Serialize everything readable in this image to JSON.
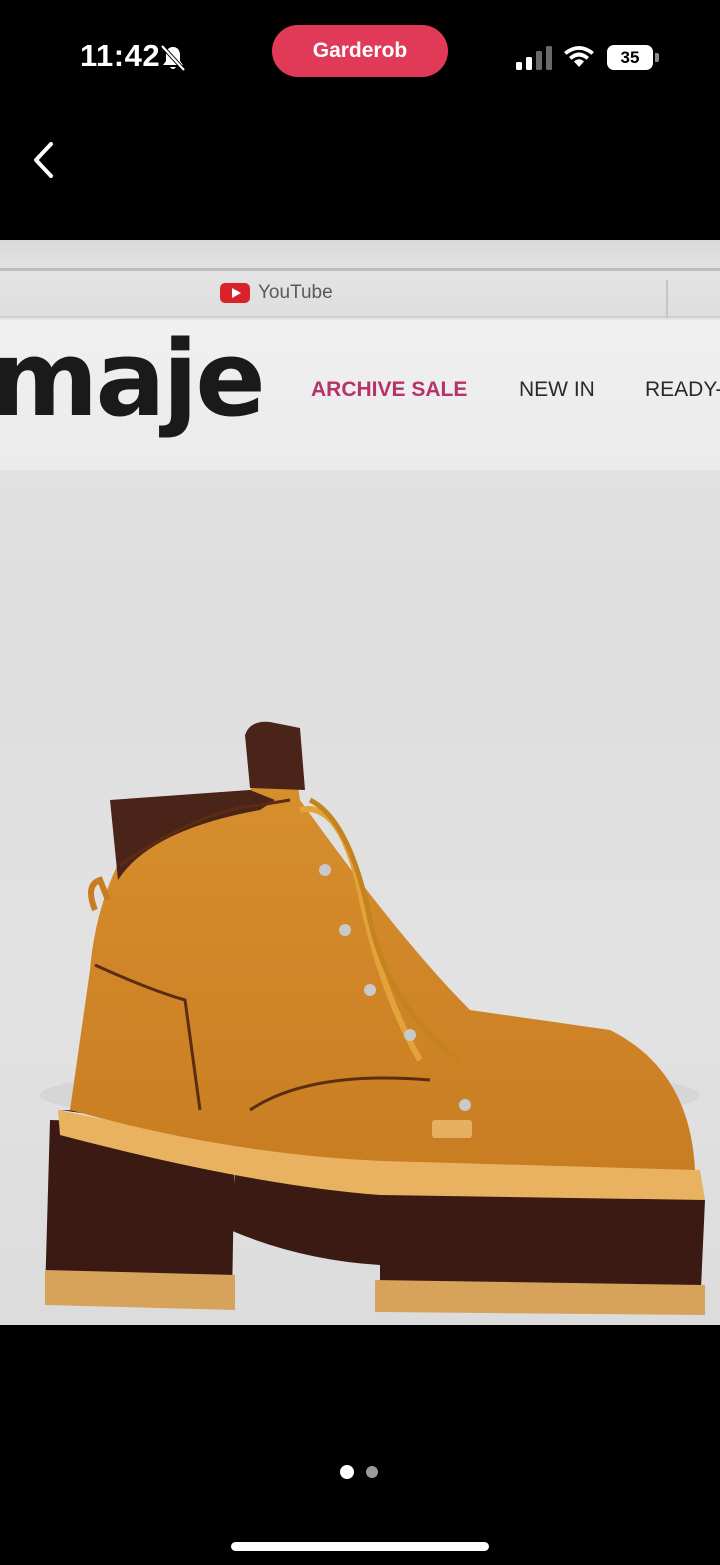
{
  "status_bar": {
    "time": "11:42",
    "app_pill_label": "Garderob",
    "battery_percent": "35"
  },
  "navigation": {
    "back_icon": "chevron-left-icon"
  },
  "photo": {
    "browser_tab_label": "YouTube",
    "site_brand": "maje",
    "site_nav": [
      "ARCHIVE SALE",
      "NEW IN",
      "READY-T"
    ],
    "accent_color": "#b5326a"
  },
  "pager": {
    "total": 2,
    "current": 1
  },
  "colors": {
    "pill": "#e13a59",
    "background": "#000000"
  }
}
